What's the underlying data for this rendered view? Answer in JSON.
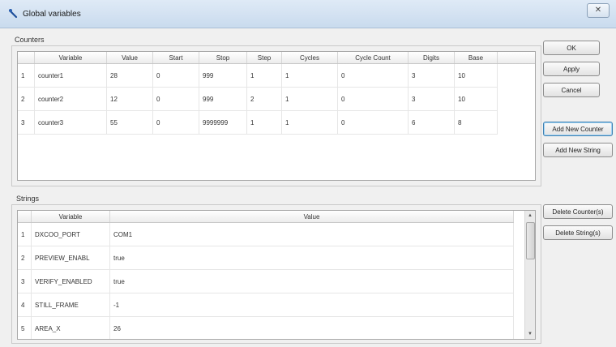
{
  "window": {
    "title": "Global variables",
    "close_glyph": "✕"
  },
  "counters": {
    "label": "Counters",
    "columns": [
      "",
      "Variable",
      "Value",
      "Start",
      "Stop",
      "Step",
      "Cycles",
      "Cycle Count",
      "Digits",
      "Base"
    ],
    "rows": [
      [
        "1",
        "counter1",
        "28",
        "0",
        "999",
        "1",
        "1",
        "0",
        "3",
        "10"
      ],
      [
        "2",
        "counter2",
        "12",
        "0",
        "999",
        "2",
        "1",
        "0",
        "3",
        "10"
      ],
      [
        "3",
        "counter3",
        "55",
        "0",
        "9999999",
        "1",
        "1",
        "0",
        "6",
        "8"
      ]
    ]
  },
  "strings": {
    "label": "Strings",
    "columns": [
      "",
      "Variable",
      "Value"
    ],
    "rows": [
      [
        "1",
        "DXCOO_PORT",
        "COM1"
      ],
      [
        "2",
        "PREVIEW_ENABL",
        "true"
      ],
      [
        "3",
        "VERIFY_ENABLED",
        "true"
      ],
      [
        "4",
        "STILL_FRAME",
        "-1"
      ],
      [
        "5",
        "AREA_X",
        "26"
      ]
    ]
  },
  "buttons": {
    "ok": "OK",
    "apply": "Apply",
    "cancel": "Cancel",
    "add_counter": "Add New Counter",
    "add_string": "Add New String",
    "delete_counters": "Delete Counter(s)",
    "delete_strings": "Delete String(s)"
  },
  "scroll": {
    "up": "▲",
    "down": "▼"
  }
}
